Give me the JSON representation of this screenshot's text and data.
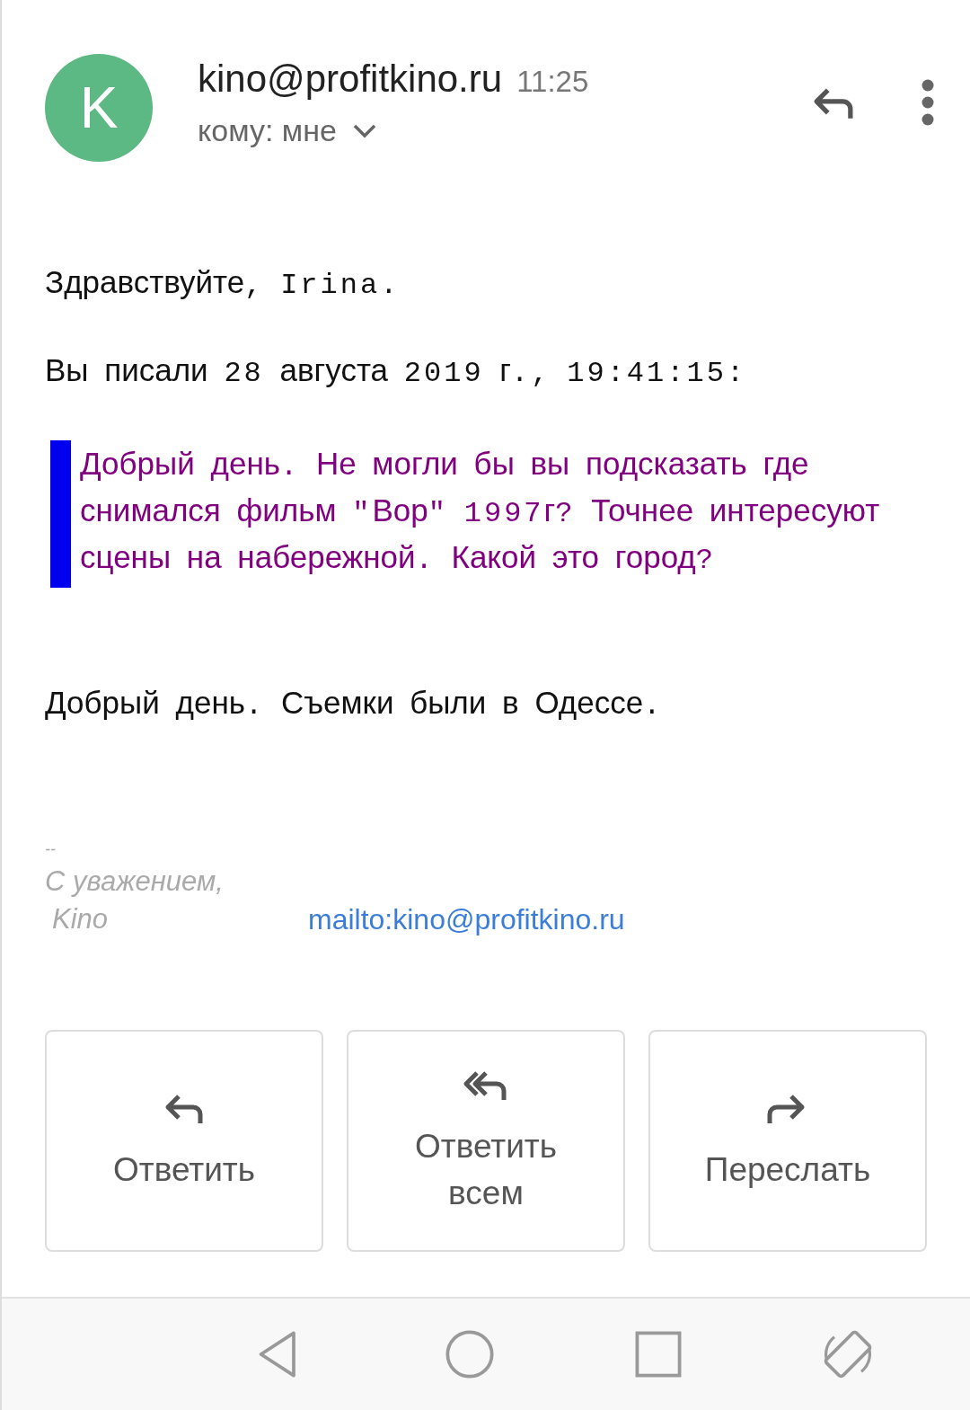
{
  "header": {
    "avatar_letter": "K",
    "sender": "kino@profitkino.ru",
    "time": "11:25",
    "recipient": "кому: мне"
  },
  "body": {
    "greeting": "Здравствуйте, Irina.",
    "quote_intro": "Вы писали 28 августа 2019 г., 19:41:15:",
    "quote": "Добрый день. Не могли бы вы подсказать где снимался фильм \"Вор\" 1997г? Точнее интересуют сцены на набережной. Какой это город?",
    "reply": "Добрый день. Съемки были в Одессе."
  },
  "signature": {
    "separator": "--",
    "closing": "С уважением,",
    "name": "Kino",
    "link": "mailto:kino@profitkino.ru"
  },
  "actions": [
    {
      "kind": "reply",
      "label": "Ответить"
    },
    {
      "kind": "reply_all",
      "label": "Ответить всем"
    },
    {
      "kind": "forward",
      "label": "Переслать"
    }
  ],
  "nav_bar": [
    {
      "kind": "back"
    },
    {
      "kind": "home"
    },
    {
      "kind": "recents"
    },
    {
      "kind": "rotate"
    }
  ]
}
